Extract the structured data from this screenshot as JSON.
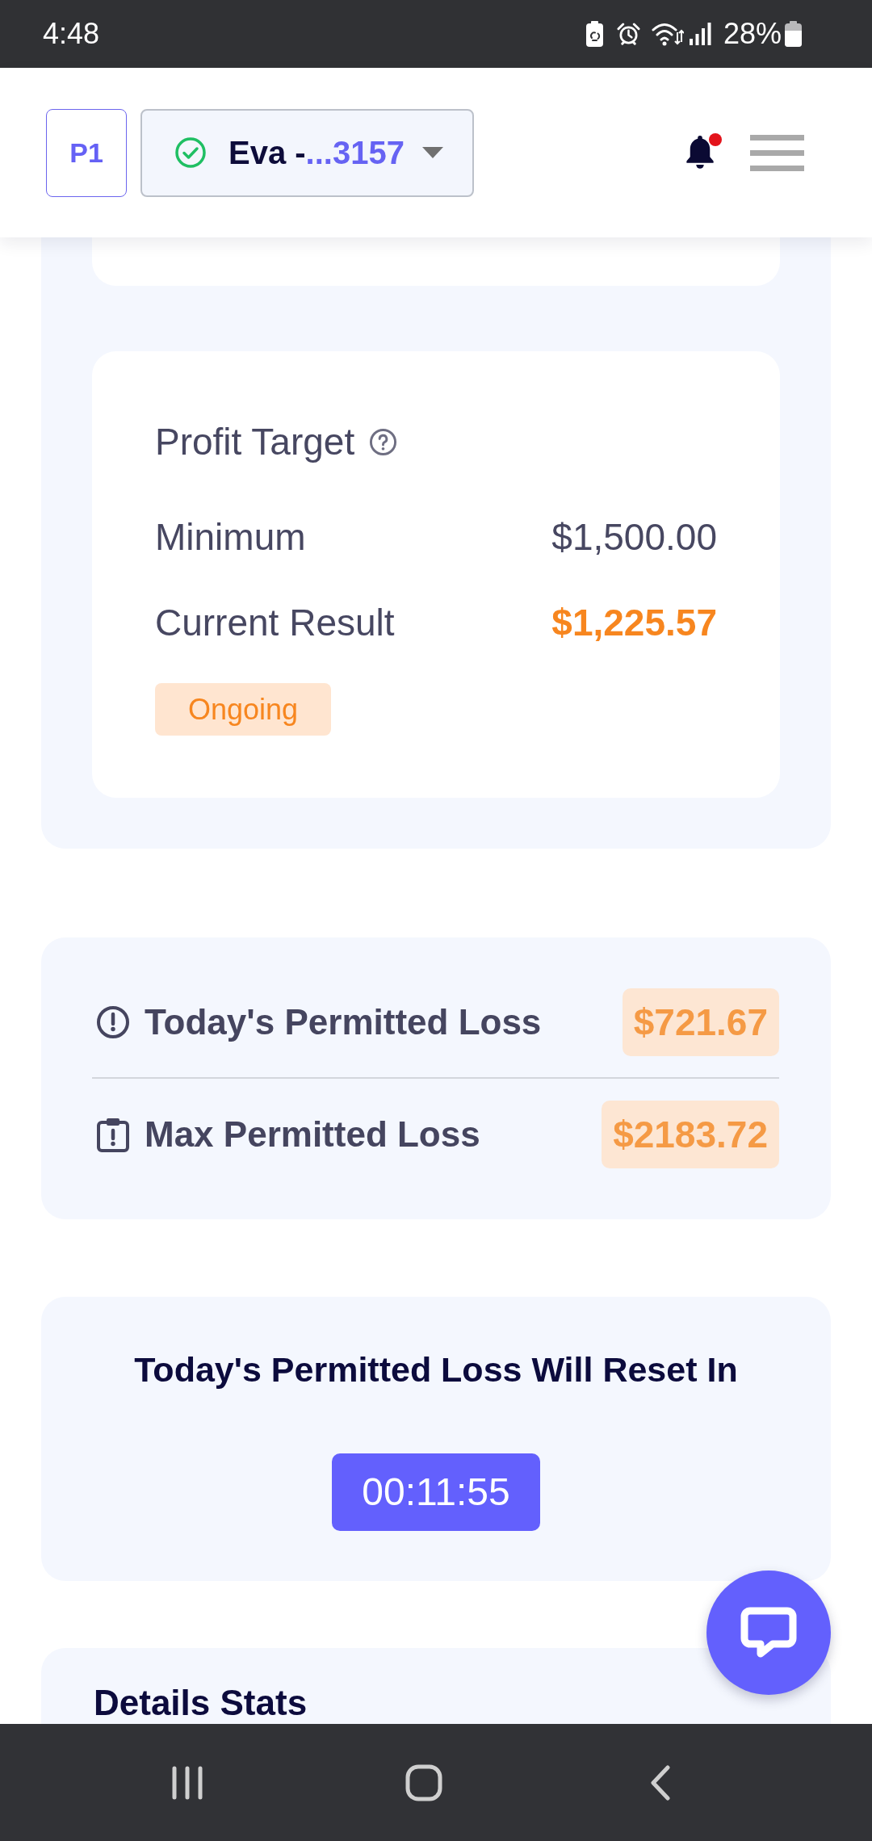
{
  "status_bar": {
    "time": "4:48",
    "battery": "28%"
  },
  "header": {
    "profile": "P1",
    "account": {
      "name": "Eva -",
      "number": "...3157",
      "verified": true
    },
    "notifications": {
      "unread": true
    }
  },
  "profit_target": {
    "title": "Profit Target",
    "rows": [
      {
        "label": "Minimum",
        "value": "$1,500.00",
        "kind": "plain"
      },
      {
        "label": "Current Result",
        "value": "$1,225.57",
        "kind": "accent"
      }
    ],
    "status": "Ongoing"
  },
  "loss_limits": [
    {
      "kind": "daily",
      "label": "Today's Permitted Loss",
      "value": "$721.67"
    },
    {
      "kind": "overall",
      "label": "Max Permitted Loss",
      "value": "$2183.72"
    }
  ],
  "reset": {
    "title": "Today's Permitted Loss Will Reset In",
    "countdown": "00:11:55"
  },
  "details": {
    "title": "Details Stats"
  }
}
